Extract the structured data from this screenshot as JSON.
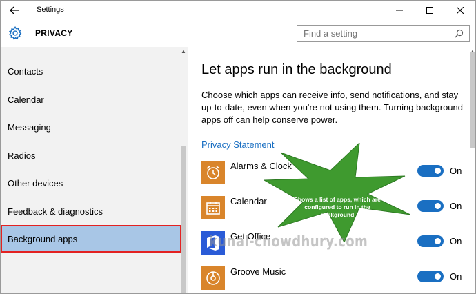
{
  "window": {
    "title": "Settings"
  },
  "header": {
    "section": "PRIVACY",
    "search_placeholder": "Find a setting"
  },
  "sidebar": {
    "items": [
      {
        "label": "Contacts",
        "active": false
      },
      {
        "label": "Calendar",
        "active": false
      },
      {
        "label": "Messaging",
        "active": false
      },
      {
        "label": "Radios",
        "active": false
      },
      {
        "label": "Other devices",
        "active": false
      },
      {
        "label": "Feedback & diagnostics",
        "active": false
      },
      {
        "label": "Background apps",
        "active": true
      }
    ]
  },
  "main": {
    "title": "Let apps run in the background",
    "description": "Choose which apps can receive info, send notifications, and stay up-to-date, even when you're not using them. Turning background apps off can help conserve power.",
    "privacy_link": "Privacy Statement",
    "apps": [
      {
        "name": "Alarms & Clock",
        "state": "On",
        "icon": "alarm-clock-icon",
        "color": "#d9852b"
      },
      {
        "name": "Calendar",
        "state": "On",
        "icon": "calendar-icon",
        "color": "#d9852b"
      },
      {
        "name": "Get Office",
        "state": "On",
        "icon": "office-icon",
        "color": "#2a5bd7"
      },
      {
        "name": "Groove Music",
        "state": "On",
        "icon": "music-disc-icon",
        "color": "#d9852b"
      }
    ]
  },
  "annotation": {
    "callout": "Shows a list of apps, which are configured to run in the background",
    "watermark": "kunal-chowdhury.com"
  },
  "colors": {
    "accent": "#1a6fc2",
    "active_item": "#a8c6e6",
    "highlight_border": "#e32222",
    "callout": "#3f9a2f"
  }
}
